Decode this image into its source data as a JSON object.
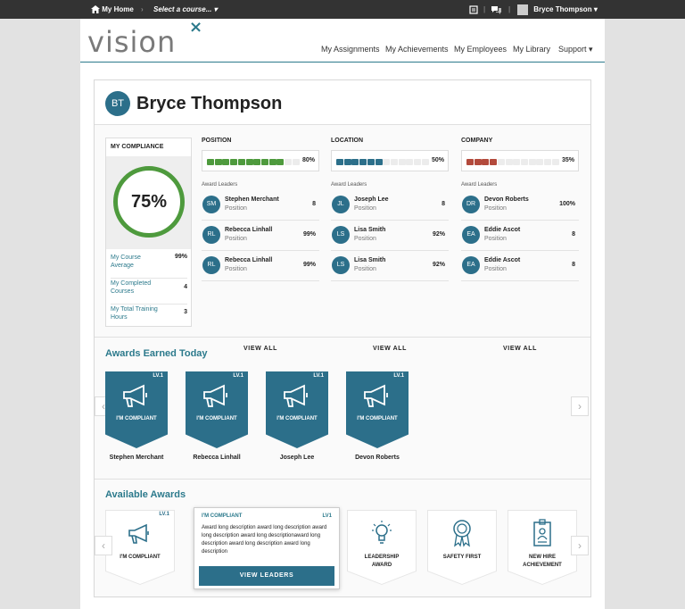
{
  "topbar": {
    "home": "My Home",
    "course": "Select a course...",
    "user": "Bryce Thompson"
  },
  "logo": {
    "text": "vision",
    "mark": "×"
  },
  "nav": [
    "My Assignments",
    "My Achievements",
    "My Employees",
    "My Library",
    "Support"
  ],
  "profile": {
    "initials": "BT",
    "name": "Bryce Thompson"
  },
  "compliance": {
    "title": "MY COMPLIANCE",
    "percent": "75%",
    "stats": [
      {
        "label": "My Course Average",
        "value": "99%"
      },
      {
        "label": "My Completed Courses",
        "value": "4"
      },
      {
        "label": "My Total Training Hours",
        "value": "3"
      }
    ]
  },
  "columns": [
    {
      "heading": "POSITION",
      "value": "80%",
      "fraction": 0.8,
      "color": "#4e9a3d",
      "leaders": [
        {
          "initials": "SM",
          "name": "Stephen Merchant",
          "role": "Position",
          "value": "8"
        },
        {
          "initials": "RL",
          "name": "Rebecca Linhall",
          "role": "Position",
          "value": "99%"
        },
        {
          "initials": "RL",
          "name": "Rebecca Linhall",
          "role": "Position",
          "value": "99%"
        }
      ]
    },
    {
      "heading": "LOCATION",
      "value": "50%",
      "fraction": 0.5,
      "color": "#2c6f8a",
      "leaders": [
        {
          "initials": "JL",
          "name": "Joseph Lee",
          "role": "Position",
          "value": "8"
        },
        {
          "initials": "LS",
          "name": "Lisa Smith",
          "role": "Position",
          "value": "92%"
        },
        {
          "initials": "LS",
          "name": "Lisa Smith",
          "role": "Position",
          "value": "92%"
        }
      ]
    },
    {
      "heading": "COMPANY",
      "value": "35%",
      "fraction": 0.35,
      "color": "#b34a3c",
      "leaders": [
        {
          "initials": "DR",
          "name": "Devon Roberts",
          "role": "Position",
          "value": "100%"
        },
        {
          "initials": "EA",
          "name": "Eddie Ascot",
          "role": "Position",
          "value": "8"
        },
        {
          "initials": "EA",
          "name": "Eddie Ascot",
          "role": "Position",
          "value": "8"
        }
      ]
    }
  ],
  "award_leaders_label": "Award Leaders",
  "view_all": "VIEW ALL",
  "awards_today": {
    "title": "Awards Earned Today",
    "items": [
      {
        "level": "LV.1",
        "label": "I'M COMPLIANT",
        "person": "Stephen Merchant"
      },
      {
        "level": "LV.1",
        "label": "I'M COMPLIANT",
        "person": "Rebecca Linhall"
      },
      {
        "level": "LV.1",
        "label": "I'M COMPLIANT",
        "person": "Joseph Lee"
      },
      {
        "level": "LV.1",
        "label": "I'M COMPLIANT",
        "person": "Devon Roberts"
      }
    ]
  },
  "available": {
    "title": "Available Awards",
    "first": {
      "level": "LV.1",
      "label": "I'M COMPLIANT"
    },
    "items": [
      {
        "label1": "LEADERSHIP",
        "label2": "AWARD"
      },
      {
        "label1": "SAFETY FIRST",
        "label2": ""
      },
      {
        "label1": "NEW HIRE",
        "label2": "ACHIEVEMENT"
      }
    ]
  },
  "popover": {
    "title": "I'M COMPLIANT",
    "level": "LV1",
    "description": "Award long description award long description award long description award long descriptionaward long description award long description award long description",
    "button": "VIEW LEADERS"
  }
}
